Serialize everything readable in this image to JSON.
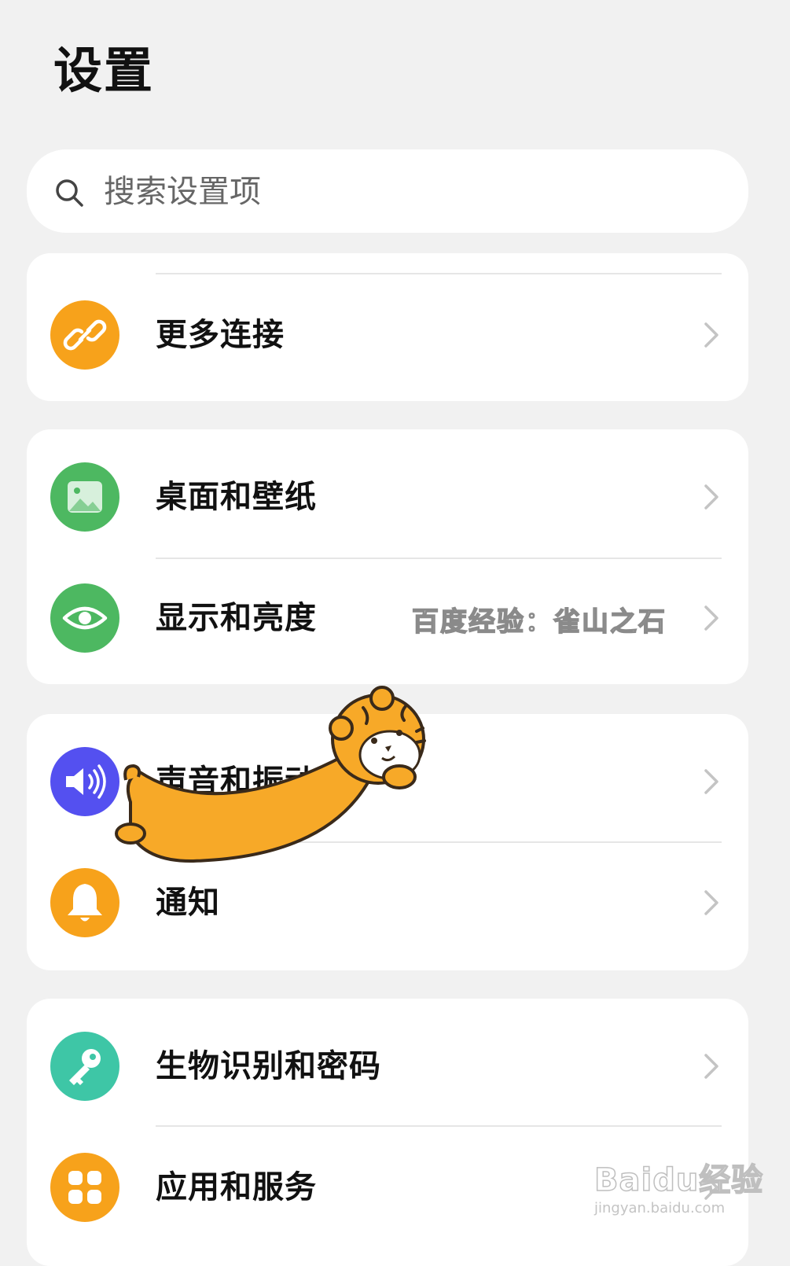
{
  "header": {
    "title": "设置"
  },
  "search": {
    "placeholder": "搜索设置项",
    "icon": "search-icon"
  },
  "groups": [
    {
      "items": [
        {
          "label": "更多连接",
          "icon": "link-icon",
          "icon_color": "#F7A21B"
        }
      ]
    },
    {
      "items": [
        {
          "label": "桌面和壁纸",
          "icon": "picture-icon",
          "icon_color": "#4DB861"
        },
        {
          "label": "显示和亮度",
          "icon": "eye-icon",
          "icon_color": "#4DB861"
        }
      ]
    },
    {
      "items": [
        {
          "label": "声音和振动",
          "icon": "speaker-icon",
          "icon_color": "#5450F0"
        },
        {
          "label": "通知",
          "icon": "bell-icon",
          "icon_color": "#F7A21B"
        }
      ]
    },
    {
      "items": [
        {
          "label": "生物识别和密码",
          "icon": "key-icon",
          "icon_color": "#3EC6A6"
        },
        {
          "label": "应用和服务",
          "icon": "apps-grid-icon",
          "icon_color": "#F7A21B"
        }
      ]
    }
  ],
  "watermarks": {
    "caption": "百度经验：雀山之石",
    "brand": "Baidu经验",
    "url": "jingyan.baidu.com"
  },
  "colors": {
    "background": "#F1F1F1",
    "card": "#FFFFFF",
    "chevron": "#C4C4C4",
    "tiger": "#F7A928"
  }
}
